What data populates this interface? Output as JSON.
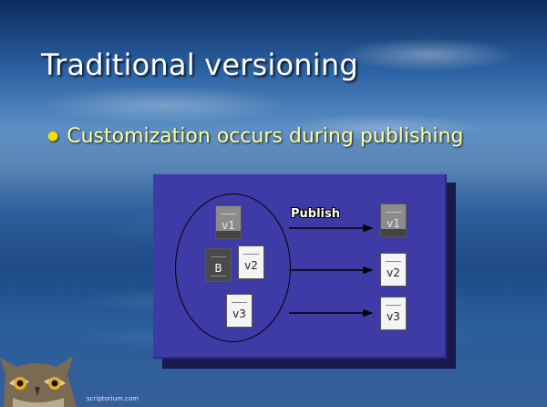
{
  "slide": {
    "title": "Traditional versioning",
    "bullet": "Customization occurs during publishing",
    "footer": "scriptorium.com"
  },
  "diagram": {
    "arrow_label": "Publish",
    "source_docs": [
      {
        "label": "v1",
        "style": "grey"
      },
      {
        "label": "B",
        "style": "dark"
      },
      {
        "label": "v2",
        "style": "light"
      },
      {
        "label": "v3",
        "style": "light"
      }
    ],
    "output_docs": [
      {
        "label": "v1",
        "style": "grey"
      },
      {
        "label": "v2",
        "style": "light"
      },
      {
        "label": "v3",
        "style": "light"
      }
    ]
  },
  "colors": {
    "title": "#ffffff",
    "bullet_text": "#ffff99",
    "diagram_fill": "#3e3aa6"
  }
}
